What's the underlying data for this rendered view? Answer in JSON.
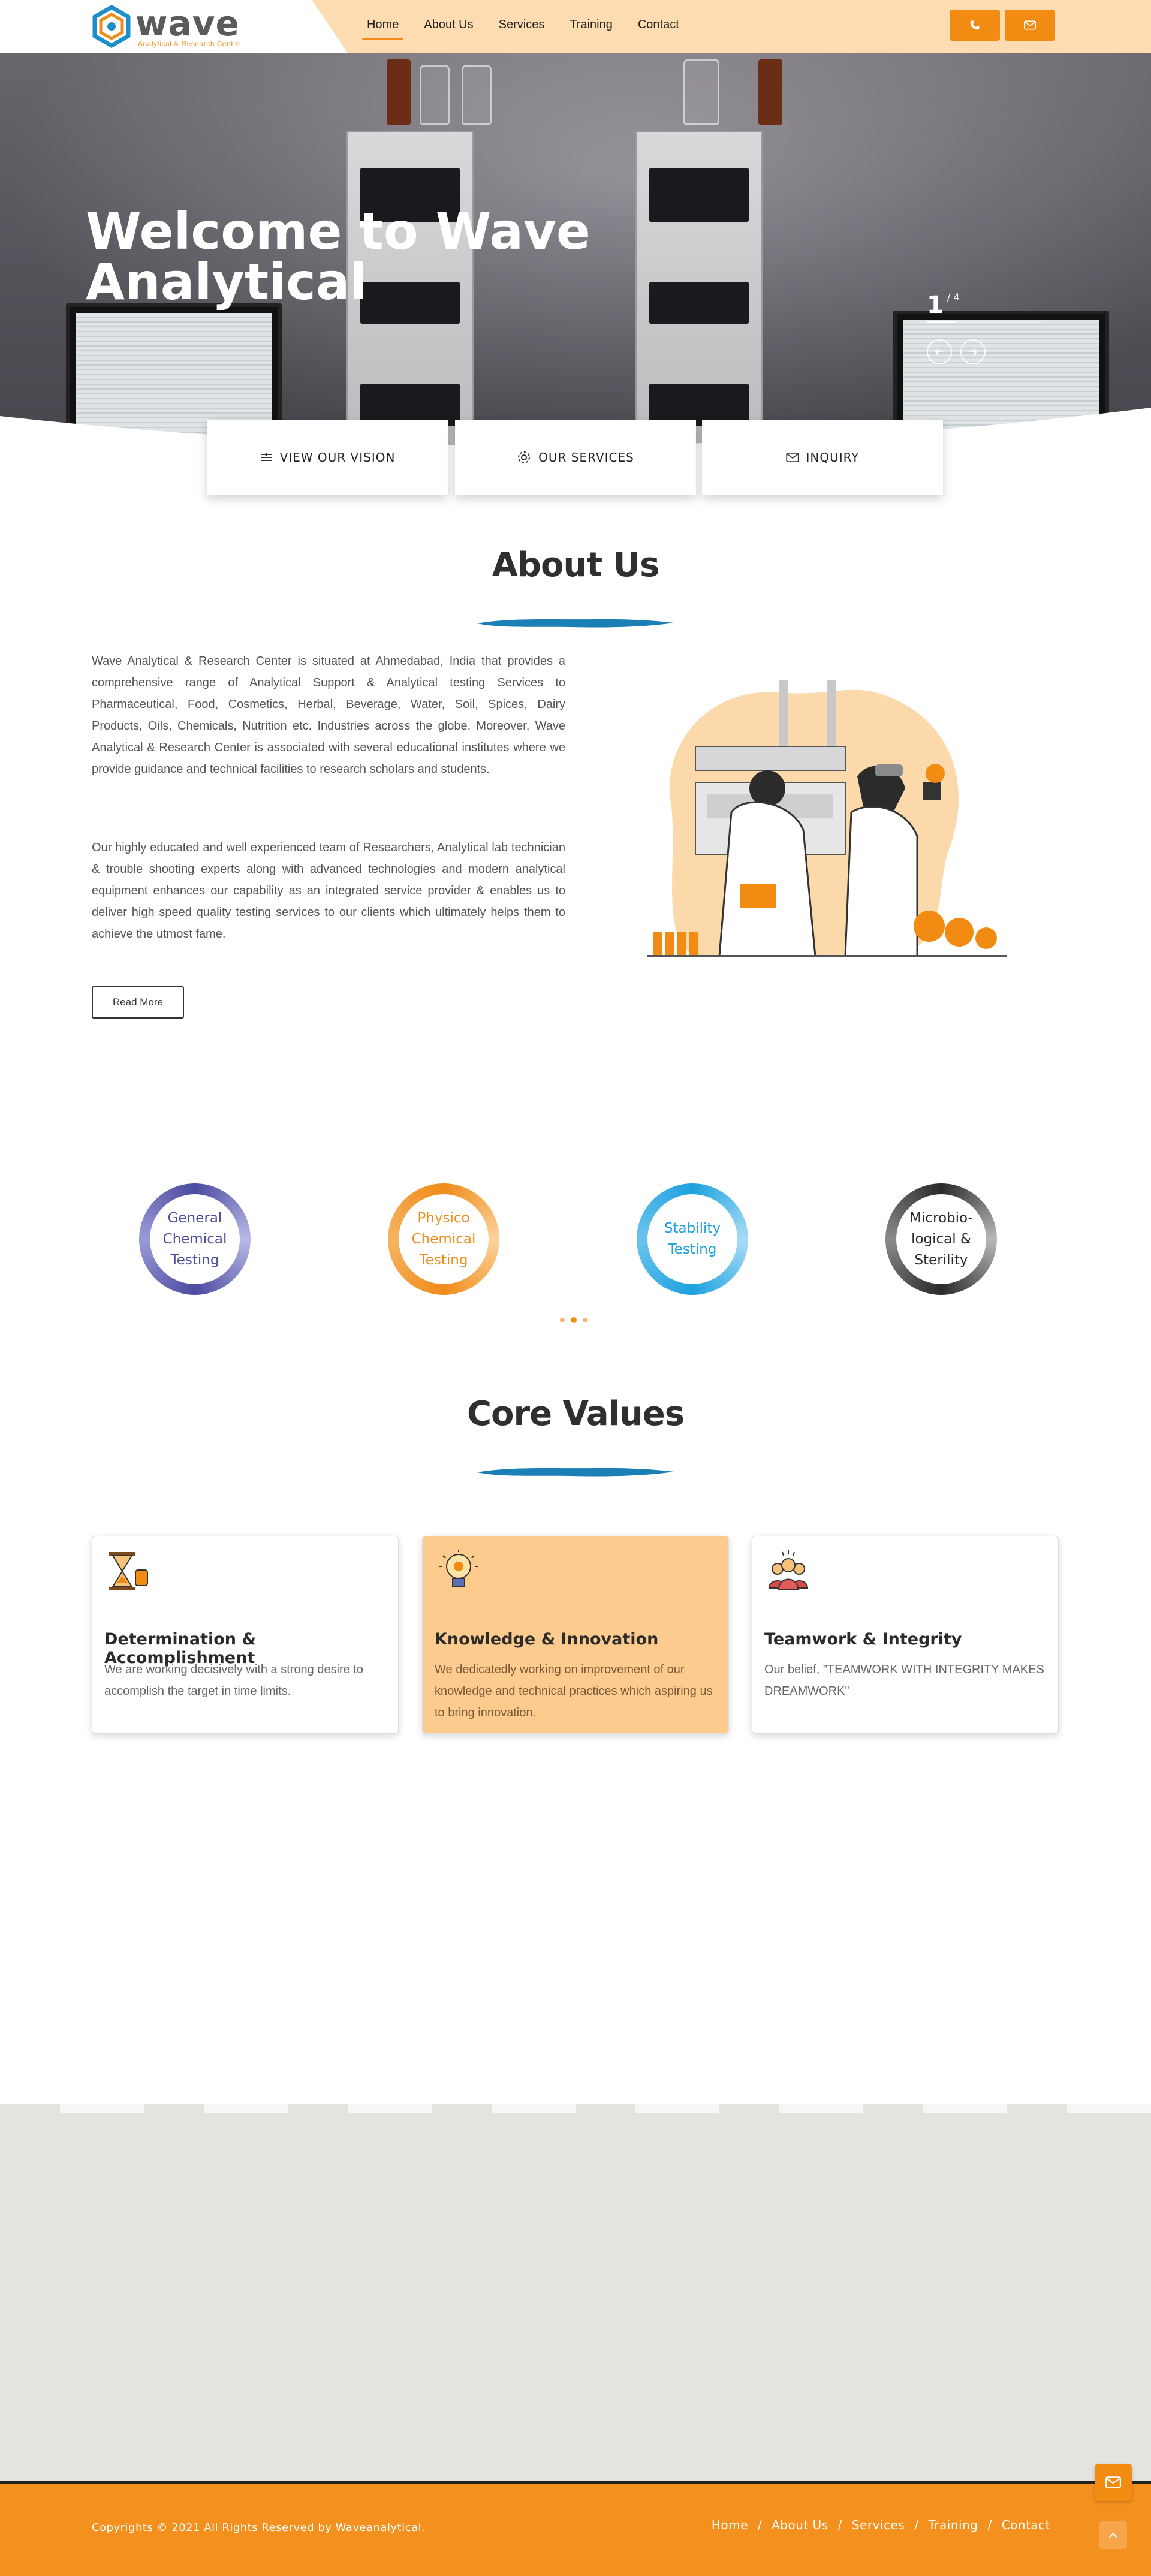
{
  "header": {
    "logo": {
      "brand": "wave",
      "tagline": "Analytical & Research Centre"
    },
    "nav": [
      {
        "label": "Home",
        "active": true
      },
      {
        "label": "About Us"
      },
      {
        "label": "Services"
      },
      {
        "label": "Training"
      },
      {
        "label": "Contact"
      }
    ],
    "buttons": {
      "phone_icon": "phone-icon",
      "mail_icon": "mail-icon"
    }
  },
  "hero": {
    "title_line1": "Welcome to Wave",
    "title_line2": "Analytical",
    "slide_current": "1",
    "slide_total": "/ 4",
    "slide_progress": 0.25,
    "prev_icon": "arrow-left-icon",
    "next_icon": "arrow-right-icon"
  },
  "quick_links": [
    {
      "label": "VIEW OUR VISION",
      "icon": "layers-icon"
    },
    {
      "label": "OUR SERVICES",
      "icon": "gear-icon"
    },
    {
      "label": "INQUIRY",
      "icon": "envelope-icon"
    }
  ],
  "about": {
    "title": "About Us",
    "para1": "Wave Analytical & Research Center is situated at Ahmedabad, India that provides a comprehensive range of Analytical Support & Analytical testing Services to Pharmaceutical, Food, Cosmetics, Herbal, Beverage, Water, Soil, Spices, Dairy Products, Oils, Chemicals, Nutrition etc. Industries across the globe. Moreover, Wave Analytical & Research Center is associated with several educational institutes where we provide guidance and technical facilities to research scholars and students.",
    "para2": "Our highly educated and well experienced team of Researchers, Analytical lab technician & trouble shooting experts along with advanced technologies and modern analytical equipment enhances our capability as an integrated service provider & enables us to deliver high speed quality testing services to our clients which ultimately helps them to achieve the utmost fame.",
    "read_more": "Read More"
  },
  "services": {
    "items": [
      {
        "line1": "General",
        "line2": "Chemical",
        "line3": "Testing",
        "color": "#5a5aa8"
      },
      {
        "line1": "Physico",
        "line2": "Chemical",
        "line3": "Testing",
        "color": "#f0901c"
      },
      {
        "line1": "Stability",
        "line2": "Testing",
        "line3": "",
        "color": "#2aa5dc"
      },
      {
        "line1": "Microbio-",
        "line2": "logical &",
        "line3": "Sterility",
        "color": "#3a3a3a"
      }
    ],
    "pager_active": 1
  },
  "core_values": {
    "title": "Core Values",
    "cards": [
      {
        "title": "Determination & Accomplishment",
        "text": "We are working decisively with a strong desire to accomplish the target in time limits.",
        "icon": "hourglass-icon"
      },
      {
        "title": "Knowledge & Innovation",
        "text": "We dedicatedly working on improvement of our knowledge and technical practices which aspiring us to bring innovation.",
        "icon": "lightbulb-icon"
      },
      {
        "title": "Teamwork & Integrity",
        "text": "Our belief, \"TEAMWORK WITH INTEGRITY MAKES DREAMWORK\"",
        "icon": "team-icon"
      }
    ]
  },
  "footer": {
    "copyright": "Copyrights © 2021 All Rights Reserved by Waveanalytical.",
    "links": [
      "Home",
      "About Us",
      "Services",
      "Training",
      "Contact"
    ],
    "separator": "/"
  },
  "colors": {
    "accent": "#f28b12",
    "header_bg": "#fcdcb0",
    "brush_blue": "#1a7fb5",
    "highlight_card": "#fdcb8e"
  }
}
